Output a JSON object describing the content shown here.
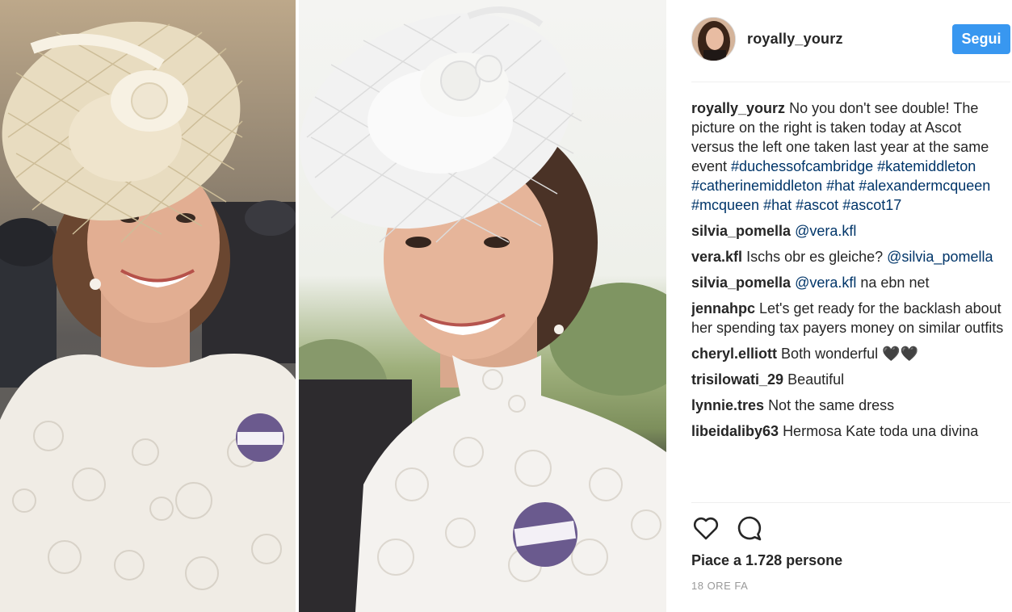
{
  "post": {
    "username": "royally_yourz",
    "follow_label": "Segui"
  },
  "comments": [
    {
      "user": "royally_yourz",
      "parts": [
        {
          "t": "text",
          "v": "No you don't see double! The picture on the right is taken today at Ascot versus the left one taken last year at the same event "
        },
        {
          "t": "link",
          "v": "#duchessofcambridge"
        },
        {
          "t": "text",
          "v": " "
        },
        {
          "t": "link",
          "v": "#katemiddleton"
        },
        {
          "t": "text",
          "v": " "
        },
        {
          "t": "link",
          "v": "#catherinemiddleton"
        },
        {
          "t": "text",
          "v": " "
        },
        {
          "t": "link",
          "v": "#hat"
        },
        {
          "t": "text",
          "v": " "
        },
        {
          "t": "link",
          "v": "#alexandermcqueen"
        },
        {
          "t": "text",
          "v": " "
        },
        {
          "t": "link",
          "v": "#mcqueen"
        },
        {
          "t": "text",
          "v": " "
        },
        {
          "t": "link",
          "v": "#hat"
        },
        {
          "t": "text",
          "v": " "
        },
        {
          "t": "link",
          "v": "#ascot"
        },
        {
          "t": "text",
          "v": " "
        },
        {
          "t": "link",
          "v": "#ascot17"
        }
      ]
    },
    {
      "user": "silvia_pomella",
      "parts": [
        {
          "t": "link",
          "v": "@vera.kfl"
        }
      ]
    },
    {
      "user": "vera.kfl",
      "parts": [
        {
          "t": "text",
          "v": "Ischs obr es gleiche? "
        },
        {
          "t": "link",
          "v": "@silvia_pomella"
        }
      ]
    },
    {
      "user": "silvia_pomella",
      "parts": [
        {
          "t": "link",
          "v": "@vera.kfl"
        },
        {
          "t": "text",
          "v": " na ebn net"
        }
      ]
    },
    {
      "user": "jennahpc",
      "parts": [
        {
          "t": "text",
          "v": "Let's get ready for the backlash about her spending tax payers money on similar outfits"
        }
      ]
    },
    {
      "user": "cheryl.elliott",
      "parts": [
        {
          "t": "text",
          "v": "Both wonderful 🖤🖤"
        }
      ]
    },
    {
      "user": "trisilowati_29",
      "parts": [
        {
          "t": "text",
          "v": "Beautiful"
        }
      ]
    },
    {
      "user": "lynnie.tres",
      "parts": [
        {
          "t": "text",
          "v": "Not the same dress"
        }
      ]
    },
    {
      "user": "libeidaliby63",
      "parts": [
        {
          "t": "text",
          "v": "Hermosa Kate toda una divina"
        }
      ]
    }
  ],
  "actions": {
    "like_icon": "heart-outline-icon",
    "comment_icon": "speech-bubble-icon",
    "likes_text": "Piace a 1.728 persone",
    "time_text": "18 ORE FA"
  },
  "colors": {
    "follow_button": "#3897f0",
    "link": "#003569",
    "text": "#262626",
    "muted": "#999999",
    "divider": "#efefef"
  }
}
